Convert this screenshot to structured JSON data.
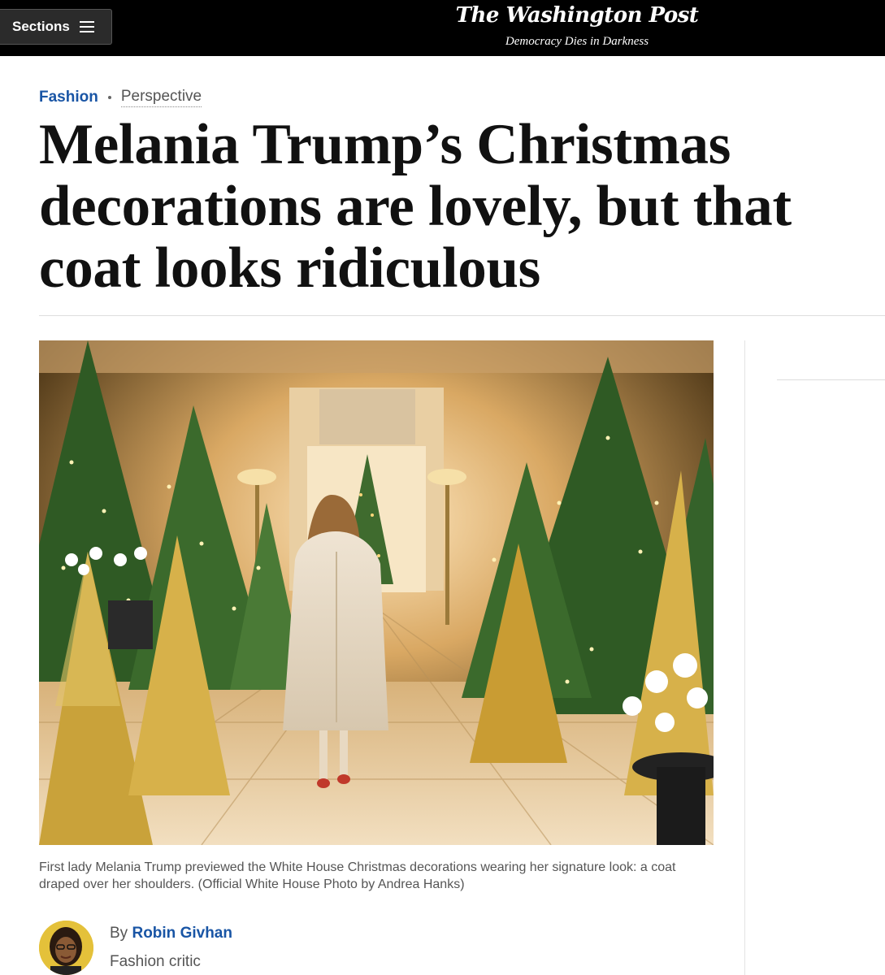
{
  "header": {
    "sections_label": "Sections",
    "sections_icon": "hamburger-icon",
    "logo_text": "The Washington Post",
    "tagline": "Democracy Dies in Darkness",
    "background": "#000000"
  },
  "article": {
    "kicker_section": "Fashion",
    "kicker_label": "Perspective",
    "headline": "Melania Trump’s Christmas decorations are lovely, but that coat looks ridiculous",
    "photo_alt": "Woman in white coat walking down White House hallway decorated with gold and green Christmas trees",
    "caption": "First lady Melania Trump previewed the White House Christmas decorations wearing her signature look: a coat draped over her shoulders. (Official White House Photo by Andrea Hanks)",
    "byline_prefix": "By",
    "author": "Robin Givhan",
    "author_role": "Fashion critic"
  },
  "colors": {
    "link_blue": "#1955a5",
    "text_dark": "#111111",
    "text_muted": "#555555"
  }
}
